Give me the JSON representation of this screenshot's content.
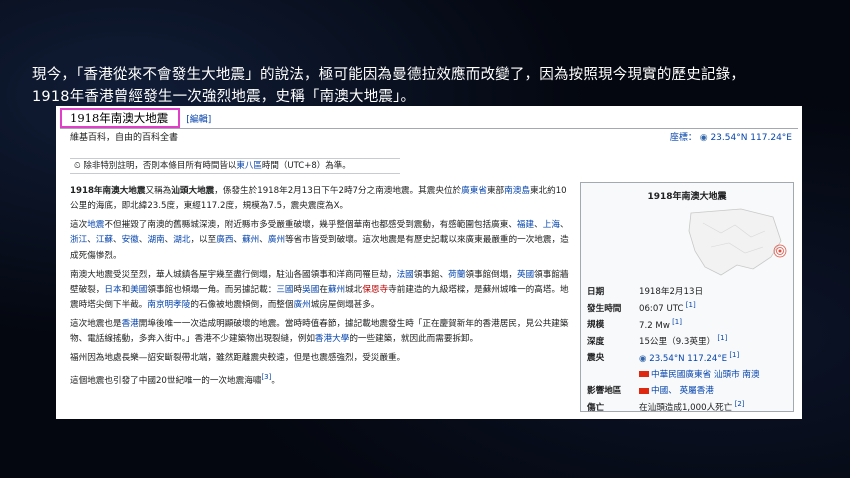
{
  "caption": {
    "line1": "現今，「香港從來不會發生大地震」的說法，極可能因為曼德拉效應而改變了，因為按照現今現實的歷史記錄，",
    "line2": "1918年香港曾經發生一次強烈地震，史稱「南澳大地震」。"
  },
  "page": {
    "title": "1918年南澳大地震",
    "edit": "[編輯]",
    "subtitle": "維基百科，自由的百科全書",
    "coords_label": "座標：",
    "coords_value": "23.54°N 117.24°E",
    "notice_prefix": "除非特別註明，否則本條目所有時間皆以",
    "notice_link": "東八區",
    "notice_suffix": "時間（UTC+8）為準。"
  },
  "article": {
    "p1": [
      {
        "t": "1918年南澳大地震",
        "s": "b"
      },
      {
        "t": "又稱為",
        "s": ""
      },
      {
        "t": "汕頭大地震",
        "s": "b"
      },
      {
        "t": "，係發生於1918年2月13日下午2時7分之南澳地震。其震央位於",
        "s": ""
      },
      {
        "t": "廣東省",
        "s": "l"
      },
      {
        "t": "東部",
        "s": ""
      },
      {
        "t": "南澳島",
        "s": "l"
      },
      {
        "t": "東北約10公里的海底，即北緯23.5度，東經117.2度，規模為7.5，震央震度為X。",
        "s": ""
      }
    ],
    "p2": [
      {
        "t": "這次",
        "s": ""
      },
      {
        "t": "地震",
        "s": "l"
      },
      {
        "t": "不但摧毀了南澳的舊縣城深澳，附近縣市多受嚴重破壞，幾乎整個華南也都感受到震動，有感範圍包括廣東、",
        "s": ""
      },
      {
        "t": "福建",
        "s": "l"
      },
      {
        "t": "、",
        "s": ""
      },
      {
        "t": "上海",
        "s": "l"
      },
      {
        "t": "、",
        "s": ""
      },
      {
        "t": "浙江",
        "s": "l"
      },
      {
        "t": "、",
        "s": ""
      },
      {
        "t": "江蘇",
        "s": "l"
      },
      {
        "t": "、",
        "s": ""
      },
      {
        "t": "安徽",
        "s": "l"
      },
      {
        "t": "、",
        "s": ""
      },
      {
        "t": "湖南",
        "s": "l"
      },
      {
        "t": "、",
        "s": ""
      },
      {
        "t": "湖北",
        "s": "l"
      },
      {
        "t": "，以至",
        "s": ""
      },
      {
        "t": "廣西",
        "s": "l"
      },
      {
        "t": "、",
        "s": ""
      },
      {
        "t": "蘇州",
        "s": "l"
      },
      {
        "t": "、",
        "s": ""
      },
      {
        "t": "廣州",
        "s": "l"
      },
      {
        "t": "等省市皆受到破壞。這次地震是有歷史記載以來廣東最嚴重的一次地震，造成死傷慘烈。",
        "s": ""
      }
    ],
    "p3": [
      {
        "t": "南澳大地震受災至烈，華人城鎮各屋宇幾至盡行倒塌，駐汕各國領事和洋商同罹巨劫，",
        "s": ""
      },
      {
        "t": "法國",
        "s": "l"
      },
      {
        "t": "領事館、",
        "s": ""
      },
      {
        "t": "荷蘭",
        "s": "l"
      },
      {
        "t": "領事館倒塌，",
        "s": ""
      },
      {
        "t": "英國",
        "s": "l"
      },
      {
        "t": "領事館牆壁破裂，",
        "s": ""
      },
      {
        "t": "日本",
        "s": "l"
      },
      {
        "t": "和",
        "s": ""
      },
      {
        "t": "美國",
        "s": "l"
      },
      {
        "t": "領事館也傾塌一角。而另據記載：",
        "s": ""
      },
      {
        "t": "三國",
        "s": "l"
      },
      {
        "t": "時",
        "s": ""
      },
      {
        "t": "吳國",
        "s": "l"
      },
      {
        "t": "在",
        "s": ""
      },
      {
        "t": "蘇州",
        "s": "l"
      },
      {
        "t": "城北",
        "s": ""
      },
      {
        "t": "保恩寺",
        "s": "red"
      },
      {
        "t": "寺前建造的九級塔樑，是蘇州城唯一的高塔。地震時塔尖倒下半截。",
        "s": ""
      },
      {
        "t": "南京明孝陵",
        "s": "l"
      },
      {
        "t": "的石像被地震傾倒，而整個",
        "s": ""
      },
      {
        "t": "廣州",
        "s": "l"
      },
      {
        "t": "城房屋倒塌甚多。",
        "s": ""
      }
    ],
    "p4": [
      {
        "t": "這次地震也是",
        "s": ""
      },
      {
        "t": "香港",
        "s": "l"
      },
      {
        "t": "開埠後唯一一次造成明顯破壞的地震。當時時值春節，據記載地震發生時「正在慶賀新年的香港居民，見公共建築物、電話線搖動，多奔入街中。」香港不少建築物出現裂縫，例如",
        "s": ""
      },
      {
        "t": "香港大學",
        "s": "l"
      },
      {
        "t": "的一些建築，就因此而需要拆卸。",
        "s": ""
      }
    ],
    "p5": [
      {
        "t": "福州因為地處長樂—詔安斷裂帶北端，雖然距離震央較遠，但是也震感強烈，受災嚴重。",
        "s": ""
      }
    ],
    "p6": [
      {
        "t": "這個地震也引發了中國20世紀唯一的一次地震海嘯",
        "s": ""
      },
      {
        "t": "[3]",
        "s": "sup"
      },
      {
        "t": "。",
        "s": ""
      }
    ]
  },
  "infobox": {
    "title": "1918年南澳大地震",
    "rows": [
      {
        "k": "日期",
        "v": "1918年2月13日",
        "sup": ""
      },
      {
        "k": "發生時間",
        "v": "06:07 UTC",
        "sup": "[1]"
      },
      {
        "k": "規模",
        "v": "7.2 Mw",
        "sup": "[1]"
      },
      {
        "k": "深度",
        "v": "15公里（9.3英里）",
        "sup": "[1]"
      },
      {
        "k": "震央",
        "v": "23.54°N 117.24°E",
        "sup": "[1]"
      },
      {
        "k": "",
        "v": "中華民國廣東省 汕頭市 南澳",
        "sup": ""
      },
      {
        "k": "影響地區",
        "v": "中國、 英屬香港",
        "sup": ""
      },
      {
        "k": "傷亡",
        "v": "在汕頭造成1,000人死亡",
        "sup": "[2]"
      }
    ]
  }
}
